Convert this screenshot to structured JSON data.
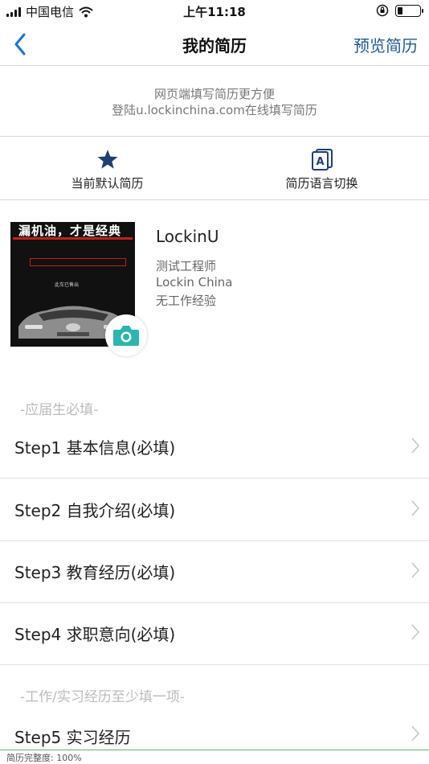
{
  "status_bar": {
    "carrier": "中国电信",
    "time": "上午11:18"
  },
  "nav": {
    "title": "我的简历",
    "preview_label": "预览简历"
  },
  "notice": {
    "line1": "网页端填写简历更方便",
    "line2": "登陆u.lockinchina.com在线填写简历"
  },
  "toolbar": {
    "default_resume_label": "当前默认简历",
    "language_switch_label": "简历语言切换",
    "language_icon_letter": "A"
  },
  "profile": {
    "name": "LockinU",
    "title": "测试工程师",
    "company": "Lockin China",
    "experience": "无工作经验",
    "avatar_poster_title": "漏机油，才是经典",
    "avatar_poster_tag": "此车已售出"
  },
  "sections": {
    "graduate_required": "-应届生必填-",
    "work_required": "-工作/实习经历至少填一项-"
  },
  "steps": [
    {
      "label": "Step1 基本信息(必填)"
    },
    {
      "label": "Step2 自我介绍(必填)"
    },
    {
      "label": "Step3 教育经历(必填)"
    },
    {
      "label": "Step4 求职意向(必填)"
    },
    {
      "label": "Step5 实习经历"
    }
  ],
  "footer": {
    "completeness": "简历完整度: 100%"
  },
  "colors": {
    "accent_blue": "#1a73c8",
    "navy_star": "#1f3f73",
    "camera_teal": "#2cb5b0",
    "progress_green": "#5fb35f"
  }
}
